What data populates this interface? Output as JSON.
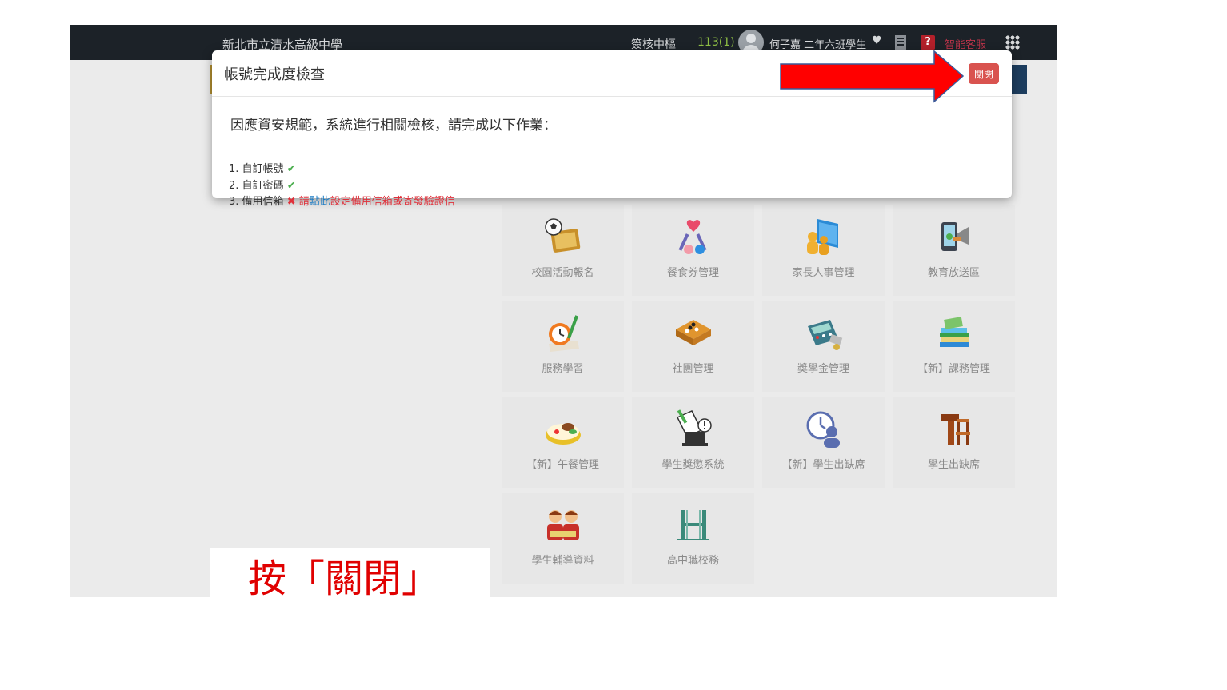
{
  "navbar": {
    "school_name": "新北市立清水高級中學",
    "sign_center": "簽核中樞",
    "year_term": "113(1)",
    "user_name": "何子嘉 二年六班學生",
    "support": "智能客服"
  },
  "dialog": {
    "title": "帳號完成度檢查",
    "close_label": "關閉",
    "intro": "因應資安規範，系統進行相關檢核，請完成以下作業：",
    "items": [
      {
        "label": "1. 自訂帳號",
        "status": "✔"
      },
      {
        "label": "2. 自訂密碼",
        "status": "✔"
      },
      {
        "label": "3. 備用信箱",
        "status": "✖",
        "prefix": "請",
        "link": "點此",
        "suffix": "設定備用信箱或寄發驗證信"
      }
    ]
  },
  "apps": [
    {
      "label": "校園活動報名",
      "icon": "soccer-board-icon"
    },
    {
      "label": "餐食券管理",
      "icon": "fork-spoon-heart-icon"
    },
    {
      "label": "家長人事管理",
      "icon": "people-book-icon"
    },
    {
      "label": "教育放送區",
      "icon": "phone-megaphone-icon"
    },
    {
      "label": "服務學習",
      "icon": "clock-pencil-icon"
    },
    {
      "label": "社團管理",
      "icon": "go-board-icon"
    },
    {
      "label": "獎學金管理",
      "icon": "calculator-money-icon"
    },
    {
      "label": "【新】課務管理",
      "icon": "books-stack-icon"
    },
    {
      "label": "【新】午餐管理",
      "icon": "lunch-box-icon"
    },
    {
      "label": "學生獎懲系統",
      "icon": "document-alert-icon"
    },
    {
      "label": "【新】學生出缺席",
      "icon": "clock-person-icon"
    },
    {
      "label": "學生出缺席",
      "icon": "desk-chair-icon"
    },
    {
      "label": "學生輔導資料",
      "icon": "students-icon"
    },
    {
      "label": "高中職校務",
      "icon": "h-logo-icon"
    }
  ],
  "caption": "按「關閉」",
  "colors": {
    "navbar": "#1c2228",
    "close_button": "#d9534f",
    "arrow": "#ff0000",
    "caption": "#e00000"
  }
}
